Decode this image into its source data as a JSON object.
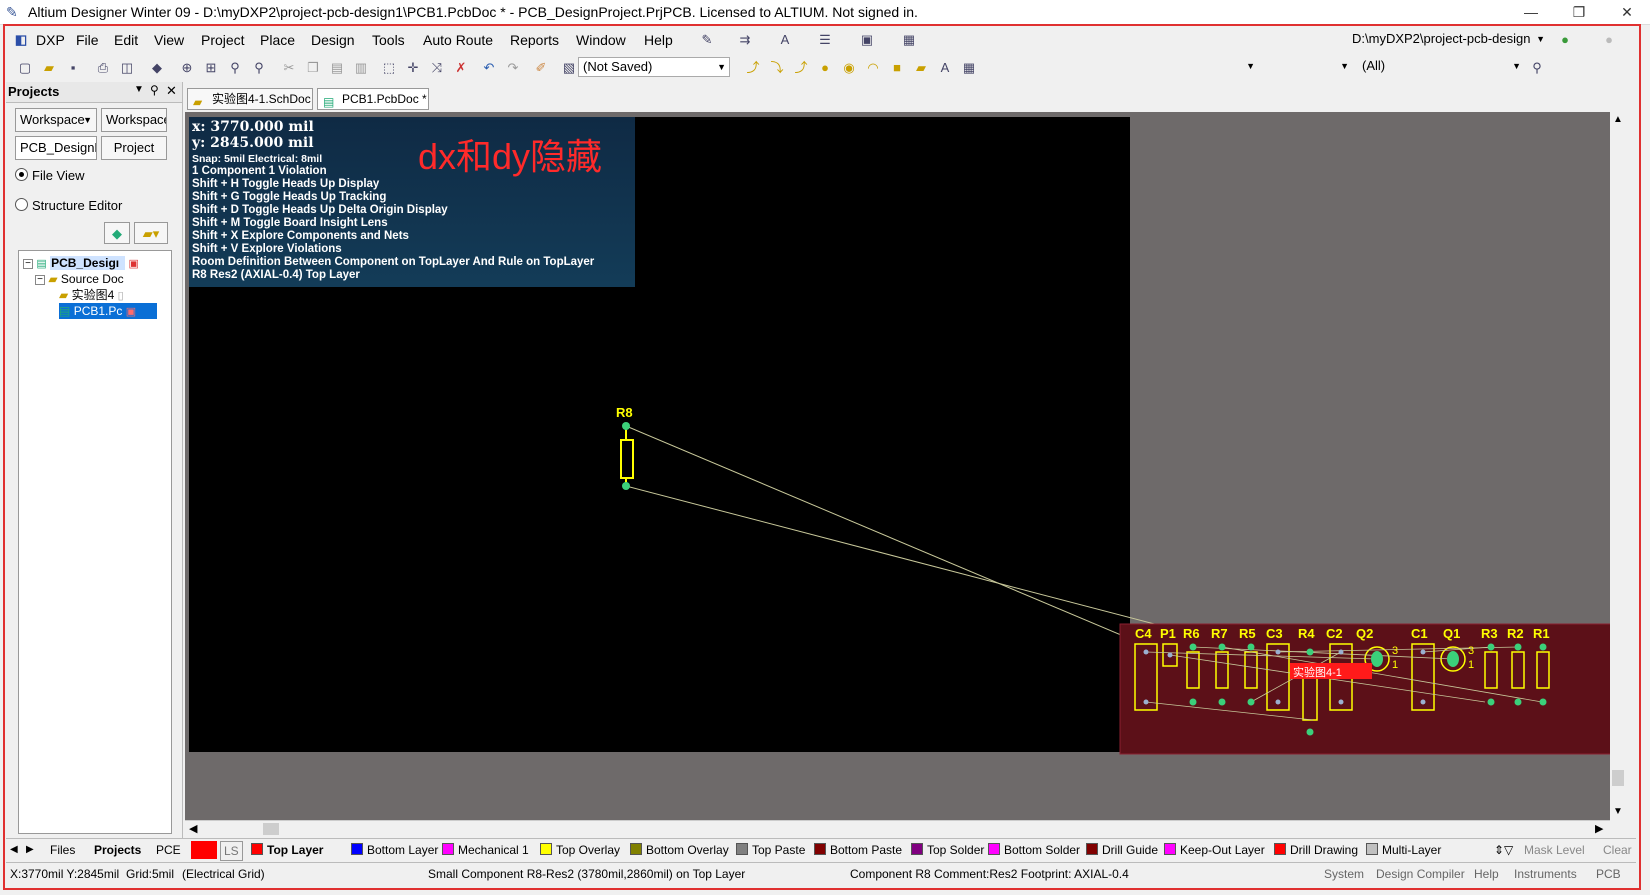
{
  "window": {
    "title": "Altium Designer Winter 09 - D:\\myDXP2\\project-pcb-design1\\PCB1.PcbDoc * - PCB_DesignProject.PrjPCB. Licensed to ALTIUM. Not signed in.",
    "minimize": "—",
    "restore": "❐",
    "close": "✕"
  },
  "menu": {
    "items": [
      "DXP",
      "File",
      "Edit",
      "View",
      "Project",
      "Place",
      "Design",
      "Tools",
      "Auto Route",
      "Reports",
      "Window",
      "Help"
    ],
    "path_combo": "D:\\myDXP2\\project-pcb-design"
  },
  "toolbar": {
    "saved_combo": "(Not Saved)",
    "filter_combo": "(All)"
  },
  "panel": {
    "title": "Projects",
    "workspace_combo": "Workspace",
    "workspace_button": "Workspace",
    "project_combo": "PCB_DesignPr",
    "project_button": "Project",
    "file_view": "File View",
    "structure_editor": "Structure Editor",
    "tree": {
      "project": "PCB_Desigı",
      "source_folder": "Source Doc",
      "sch_doc": "实验图4",
      "pcb_doc": "PCB1.Pc"
    }
  },
  "doc_tabs": [
    "实验图4-1.SchDoc",
    "PCB1.PcbDoc *"
  ],
  "hud": {
    "x": "x:  3770.000  mil",
    "y": "y:  2845.000  mil",
    "snap": "Snap: 5mil Electrical: 8mil",
    "violation": "1 Component 1 Violation",
    "shortcuts": [
      "Shift + H   Toggle Heads Up Display",
      "Shift + G   Toggle Heads Up Tracking",
      "Shift + D   Toggle Heads Up Delta Origin Display",
      "Shift + M  Toggle Board Insight Lens",
      "Shift + X   Explore Components and Nets",
      "Shift + V   Explore Violations"
    ],
    "room_rule": "Room Definition Between Component on TopLayer And Rule on TopLayer",
    "component": "R8  Res2 (AXIAL-0.4)  Top Layer"
  },
  "annotation": "dx和dy隐藏",
  "pcb": {
    "floating_component": "R8",
    "room_label": "实验图4-1",
    "designators": [
      "C4",
      "P1",
      "R6",
      "R7",
      "R5",
      "C3",
      "R4",
      "C2",
      "Q2",
      "C1",
      "Q1",
      "R3",
      "R2",
      "R1"
    ],
    "pin_labels": [
      "3",
      "1",
      "3",
      "1"
    ]
  },
  "panel_tabs": [
    "Files",
    "Projects",
    "PCE"
  ],
  "layers": [
    {
      "name": "LS",
      "color": "#ff0000"
    },
    {
      "name": "Top Layer",
      "color": "#ff0000"
    },
    {
      "name": "Bottom Layer",
      "color": "#0000ff"
    },
    {
      "name": "Mechanical 1",
      "color": "#ff00ff"
    },
    {
      "name": "Top Overlay",
      "color": "#ffff00"
    },
    {
      "name": "Bottom Overlay",
      "color": "#808000"
    },
    {
      "name": "Top Paste",
      "color": "#808080"
    },
    {
      "name": "Bottom Paste",
      "color": "#800000"
    },
    {
      "name": "Top Solder",
      "color": "#800080"
    },
    {
      "name": "Bottom Solder",
      "color": "#ff00ff"
    },
    {
      "name": "Drill Guide",
      "color": "#800000"
    },
    {
      "name": "Keep-Out Layer",
      "color": "#ff00ff"
    },
    {
      "name": "Drill Drawing",
      "color": "#ff0000"
    },
    {
      "name": "Multi-Layer",
      "color": "#c0c0c0"
    }
  ],
  "layer_right": {
    "mask_level": "Mask Level",
    "clear": "Clear"
  },
  "status": {
    "coords": "X:3770mil Y:2845mil",
    "grid": "Grid:5mil",
    "grid_type": "(Electrical Grid)",
    "component_info": "Small Component R8-Res2 (3780mil,2860mil) on Top Layer",
    "comment": "Component R8 Comment:Res2 Footprint: AXIAL-0.4",
    "right": [
      "System",
      "Design Compiler",
      "Help",
      "Instruments",
      "PCB"
    ]
  }
}
